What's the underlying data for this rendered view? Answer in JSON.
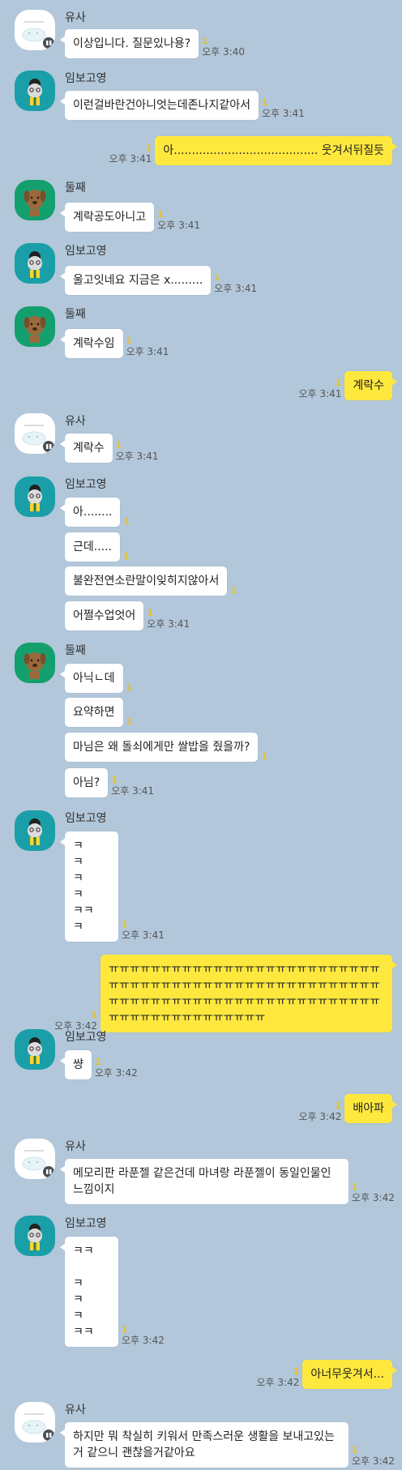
{
  "colors": {
    "background": "#b2c7da",
    "incoming_bubble": "#ffffff",
    "outgoing_bubble": "#fee83e",
    "unread_count": "#e4c232"
  },
  "messages": [
    {
      "type": "in",
      "sender": "유사",
      "avatar": "yusa",
      "lines": [
        {
          "text": "이상입니다. 질문있나용?",
          "unread": "1",
          "time": "오후 3:40"
        }
      ]
    },
    {
      "type": "in",
      "sender": "임보고영",
      "avatar": "imbo",
      "lines": [
        {
          "text": "이런걸바란건아니엇는데존나지같아서",
          "unread": "1",
          "time": "오후 3:41"
        }
      ]
    },
    {
      "type": "out",
      "lines": [
        {
          "text": "아........................................ 웃겨서뒤질듯",
          "unread": "1",
          "time": "오후 3:41"
        }
      ]
    },
    {
      "type": "in",
      "sender": "둘째",
      "avatar": "dul",
      "lines": [
        {
          "text": "계락공도아니고",
          "unread": "1",
          "time": "오후 3:41"
        }
      ]
    },
    {
      "type": "in",
      "sender": "임보고영",
      "avatar": "imbo",
      "lines": [
        {
          "text": "울고잇네요 지금은 x.........",
          "unread": "1",
          "time": "오후 3:41"
        }
      ]
    },
    {
      "type": "in",
      "sender": "둘째",
      "avatar": "dul",
      "lines": [
        {
          "text": "계락수임",
          "unread": "1",
          "time": "오후 3:41"
        }
      ]
    },
    {
      "type": "out",
      "lines": [
        {
          "text": "계락수",
          "unread": "1",
          "time": "오후 3:41"
        }
      ]
    },
    {
      "type": "in",
      "sender": "유사",
      "avatar": "yusa",
      "lines": [
        {
          "text": "계락수",
          "unread": "1",
          "time": "오후 3:41"
        }
      ]
    },
    {
      "type": "in",
      "sender": "임보고영",
      "avatar": "imbo",
      "lines": [
        {
          "text": "아........",
          "unread": "1",
          "time": ""
        },
        {
          "text": "근데.....",
          "unread": "1",
          "time": ""
        },
        {
          "text": "불완전연소란말이잊히지않아서",
          "unread": "1",
          "time": ""
        },
        {
          "text": "어쩔수업엇어",
          "unread": "1",
          "time": "오후 3:41"
        }
      ]
    },
    {
      "type": "in",
      "sender": "둘째",
      "avatar": "dul",
      "lines": [
        {
          "text": "아닉ㄴ데",
          "unread": "1",
          "time": ""
        },
        {
          "text": "요약하면",
          "unread": "1",
          "time": ""
        },
        {
          "text": "마님은 왜 돌쇠에게만 쌀밥을 줬을까?",
          "unread": "1",
          "time": ""
        },
        {
          "text": "아님?",
          "unread": "1",
          "time": "오후 3:41"
        }
      ]
    },
    {
      "type": "in",
      "sender": "임보고영",
      "avatar": "imbo",
      "lines": [
        {
          "text": "ㅋ\nㅋ\nㅋ\nㅋ\nㅋㅋ\nㅋ",
          "unread": "1",
          "time": "오후 3:41"
        }
      ]
    },
    {
      "type": "out",
      "lines": [
        {
          "text": "ㅠㅠㅠㅠㅠㅠㅠㅠㅠㅠㅠㅠㅠㅠㅠㅠㅠㅠㅠㅠㅠㅠㅠㅠㅠㅠㅠㅠㅠㅠㅠㅠㅠㅠㅠㅠㅠㅠㅠㅠㅠㅠㅠㅠㅠㅠㅠㅠㅠㅠㅠㅠㅠㅠㅠㅠㅠㅠㅠㅠㅠㅠㅠㅠㅠㅠㅠㅠㅠㅠㅠㅠㅠㅠㅠㅠㅠㅠㅠㅠㅠㅠㅠㅠㅠㅠㅠㅠㅠㅠㅠㅠㅠ",
          "unread": "1",
          "time": "오후 3:42"
        }
      ]
    },
    {
      "type": "in",
      "sender": "임보고영",
      "avatar": "imbo",
      "lines": [
        {
          "text": "썅",
          "unread": "1",
          "time": "오후 3:42"
        }
      ]
    },
    {
      "type": "out",
      "lines": [
        {
          "text": "배아파",
          "unread": "1",
          "time": "오후 3:42"
        }
      ]
    },
    {
      "type": "in",
      "sender": "유사",
      "avatar": "yusa",
      "lines": [
        {
          "text": "메모리판 라푼젤 같은건데 마녀랑 라푼젤이 동일인물인 느낌이지",
          "unread": "1",
          "time": "오후 3:42"
        }
      ]
    },
    {
      "type": "in",
      "sender": "임보고영",
      "avatar": "imbo",
      "lines": [
        {
          "text": "ㅋㅋ\n\nㅋ\nㅋ\nㅋ\nㅋㅋ",
          "unread": "1",
          "time": "오후 3:42"
        }
      ]
    },
    {
      "type": "out",
      "lines": [
        {
          "text": "아너무웃겨서...",
          "unread": "1",
          "time": "오후 3:42"
        }
      ]
    },
    {
      "type": "in",
      "sender": "유사",
      "avatar": "yusa",
      "lines": [
        {
          "text": "하지만 뭐 착실히 키워서 만족스러운 생활을 보내고있는거 같으니 괜찮을거같아요",
          "unread": "1",
          "time": "오후 3:42"
        }
      ]
    }
  ]
}
